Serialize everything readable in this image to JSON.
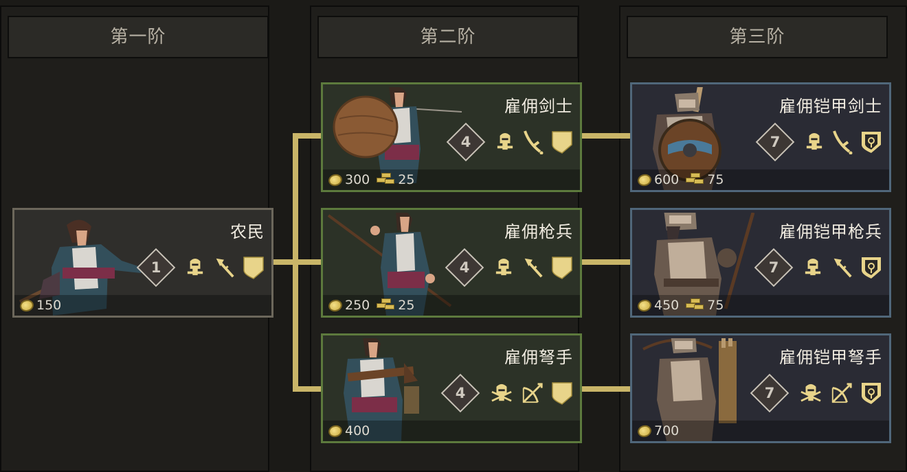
{
  "tiers": [
    {
      "label": "第一阶"
    },
    {
      "label": "第二阶"
    },
    {
      "label": "第三阶"
    }
  ],
  "units": {
    "peasant": {
      "name": "农民",
      "tier": "1",
      "cost_gold": "150"
    },
    "merc_swordsman": {
      "name": "雇佣剑士",
      "tier": "4",
      "cost_gold": "300",
      "cost_bars": "25"
    },
    "merc_spearman": {
      "name": "雇佣枪兵",
      "tier": "4",
      "cost_gold": "250",
      "cost_bars": "25"
    },
    "merc_crossbowman": {
      "name": "雇佣弩手",
      "tier": "4",
      "cost_gold": "400"
    },
    "armored_swordsman": {
      "name": "雇佣铠甲剑士",
      "tier": "7",
      "cost_gold": "600",
      "cost_bars": "75"
    },
    "armored_spearman": {
      "name": "雇佣铠甲枪兵",
      "tier": "7",
      "cost_gold": "450",
      "cost_bars": "75"
    },
    "armored_crossbowman": {
      "name": "雇佣铠甲弩手",
      "tier": "7",
      "cost_gold": "700"
    }
  },
  "colors": {
    "connector": "#c9b568",
    "icon": "#e8d48a",
    "tier1_border": "#6c675b",
    "tier2_border": "#5d7a3d",
    "tier3_border": "#50677a"
  },
  "icons": {
    "infantry": "helmet-icon",
    "ranged": "helmet-crossed-icon",
    "sword": "sword-icon",
    "spear": "spear-icon",
    "bow": "bow-icon",
    "shield": "shield-icon",
    "shield_armored": "armored-shield-icon"
  }
}
